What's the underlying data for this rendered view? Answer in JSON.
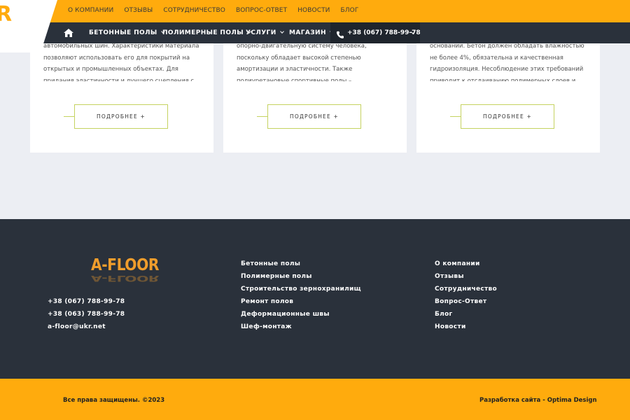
{
  "topbar": {
    "links": [
      "О КОМПАНИИ",
      "ОТЗЫВЫ",
      "СОТРУДНИЧЕСТВО",
      "ВОПРОС-ОТВЕТ",
      "НОВОСТИ",
      "БЛОГ"
    ]
  },
  "logo_fragment": "R",
  "nav": {
    "items": [
      "БЕТОННЫЕ ПОЛЫ",
      "ПОЛИМЕРНЫЕ ПОЛЫ",
      "УСЛУГИ",
      "МАГАЗИН"
    ],
    "phone": "+38 (067) 788-99-78"
  },
  "cards": [
    {
      "text": "автомобильных шин. Характеристики материала позволяют использовать его для покрытий на открытых и промышленных объектах. Для придания эластичности и лучшего сцепления с основанием к",
      "button": "ПОДРОБНЕЕ +"
    },
    {
      "text": "опорно-двигательную систему человека, поскольку обладает высокой степенью амортизации и эластичности. Также полиуретановые спортивные полы – износостойкие и ударопрочные. Различные",
      "button": "ПОДРОБНЕЕ +"
    },
    {
      "text": "основании. Бетон должен обладать влажностью не более 4%, обязательна и качественная гидроизоляция. Несоблюдение этих требований приводит к отслаиванию полимерных слоев и появлению",
      "button": "ПОДРОБНЕЕ +"
    }
  ],
  "footer": {
    "logo": "A-FLOOR",
    "contacts": [
      "+38 (067) 788-99-78",
      "+38 (063) 788-99-78",
      "a-floor@ukr.net"
    ],
    "col1": [
      "Бетонные полы",
      "Полимерные полы",
      "Строительство зернохранилищ",
      "Ремонт полов",
      "Деформационные швы",
      "Шеф-монтаж"
    ],
    "col2": [
      "О компании",
      "Отзывы",
      "Сотрудничество",
      "Вопрос-Ответ",
      "Блог",
      "Новости"
    ]
  },
  "bottom": {
    "copyright": "Все права защищены. ©2023",
    "developer": "Разработка сайта - Optima Design"
  },
  "colors": {
    "accent": "#ffab0d",
    "dark": "#2a313b",
    "button_border": "#c5d260",
    "logo": "#f09d2c"
  }
}
